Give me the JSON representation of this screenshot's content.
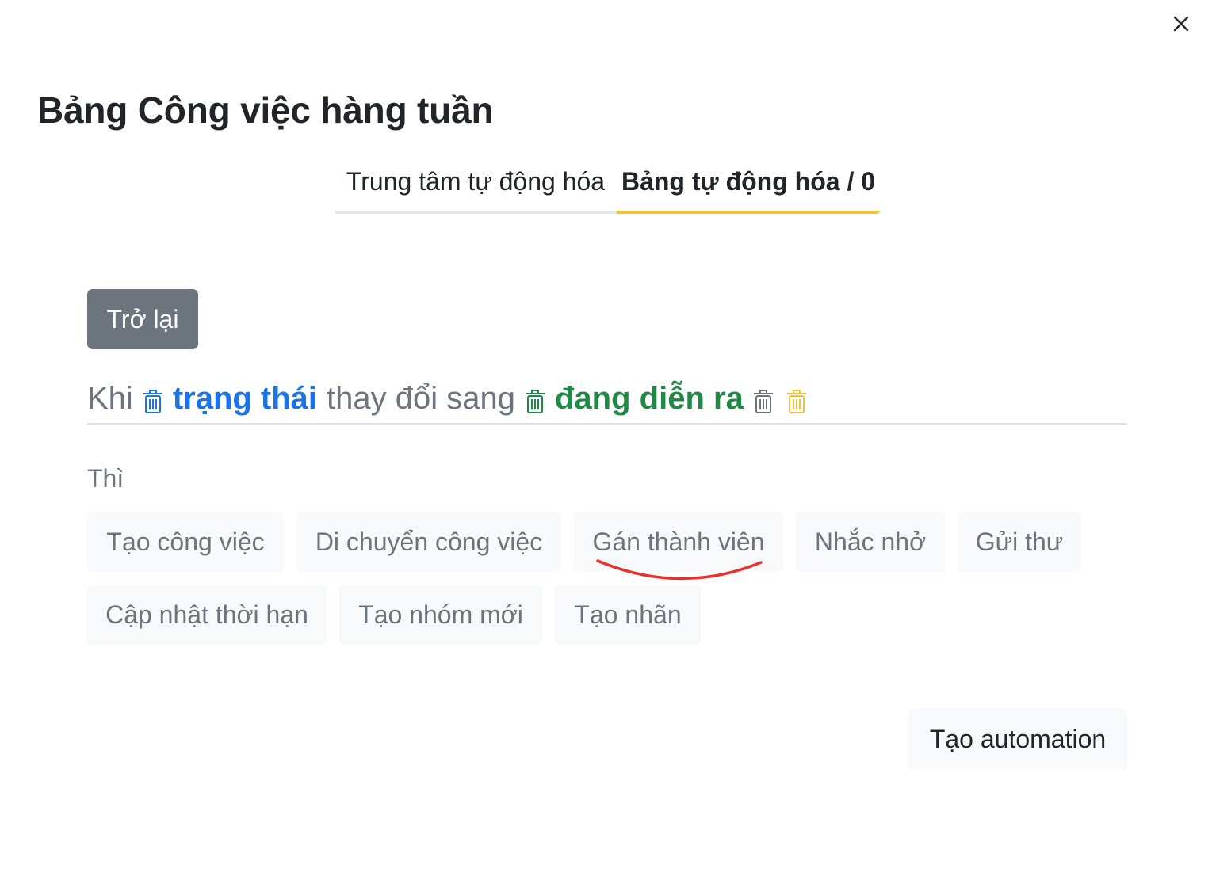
{
  "modal": {
    "title": "Bảng Công việc hàng tuần"
  },
  "tabs": [
    {
      "label": "Trung tâm tự động hóa",
      "active": false
    },
    {
      "label": "Bảng tự động hóa / 0",
      "active": true
    }
  ],
  "back_button": {
    "label": "Trở lại"
  },
  "trigger": {
    "when": "Khi",
    "field": "trạng thái",
    "changes_to": "thay đổi sang",
    "value": "đang diễn ra"
  },
  "then_label": "Thì",
  "actions": [
    {
      "label": "Tạo công việc"
    },
    {
      "label": "Di chuyển công việc"
    },
    {
      "label": "Gán thành viên"
    },
    {
      "label": "Nhắc nhở"
    },
    {
      "label": "Gửi thư"
    },
    {
      "label": "Cập nhật thời hạn"
    },
    {
      "label": "Tạo nhóm mới"
    },
    {
      "label": "Tạo nhãn"
    }
  ],
  "create_button": {
    "label": "Tạo automation"
  },
  "icons": {
    "close": "close-icon",
    "trash": "trash-icon"
  },
  "colors": {
    "accent_tab": "#f2c23a",
    "field_blue": "#1a73e8",
    "value_green": "#1e8a45",
    "trash_yellow": "#f2c23a",
    "back_button_bg": "#6c757d",
    "annotation_red": "#e8312a"
  }
}
